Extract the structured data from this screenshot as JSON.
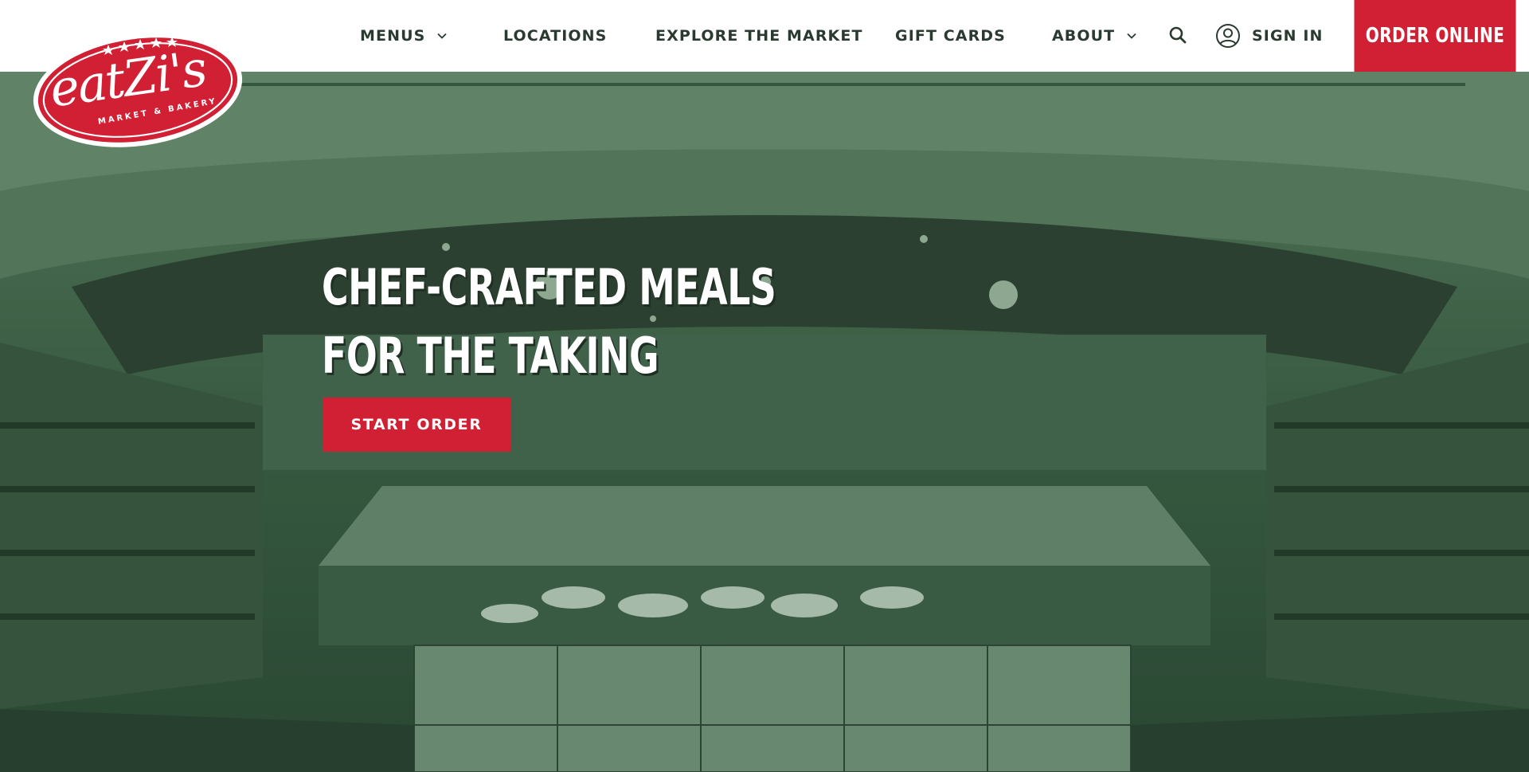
{
  "brand": {
    "logo_text": "eatZi's",
    "logo_subtext": "MARKET & BAKERY",
    "accent_color": "#d11f33",
    "header_text_color": "#2b3a30",
    "hero_tint": "#3e5f47"
  },
  "nav": {
    "menus_label": "MENUS",
    "locations_label": "LOCATIONS",
    "explore_label": "EXPLORE THE MARKET",
    "giftcards_label": "GIFT CARDS",
    "about_label": "ABOUT",
    "signin_label": "SIGN IN",
    "order_online_label": "ORDER ONLINE",
    "search_icon": "search-icon",
    "user_icon": "user-circle-icon",
    "dropdown_icon": "chevron-down-icon"
  },
  "hero": {
    "headline_line1": "CHEF-CRAFTED MEALS",
    "headline_line2": "FOR THE TAKING",
    "cta_label": "START ORDER",
    "background_description_icon": "market-interior-photo"
  }
}
